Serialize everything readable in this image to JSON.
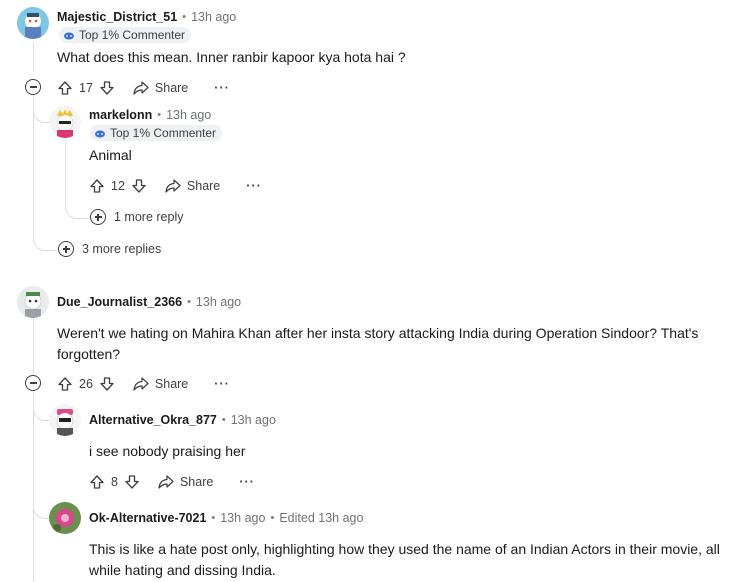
{
  "comments": [
    {
      "author": "Majestic_District_51",
      "time": "13h ago",
      "flair": "Top 1% Commenter",
      "body": "What does this mean. Inner ranbir kapoor kya hota hai ?",
      "votes": "17",
      "share": "Share",
      "more": "···"
    },
    {
      "author": "markelonn",
      "time": "13h ago",
      "flair": "Top 1% Commenter",
      "body": "Animal",
      "votes": "12",
      "share": "Share",
      "more": "···",
      "more_replies": "1 more reply"
    },
    {
      "parent_more_replies": "3 more replies"
    },
    {
      "author": "Due_Journalist_2366",
      "time": "13h ago",
      "body": "Weren't we hating on Mahira Khan after her insta story attacking India during Operation Sindoor? That's forgotten?",
      "votes": "26",
      "share": "Share",
      "more": "···"
    },
    {
      "author": "Alternative_Okra_877",
      "time": "13h ago",
      "body": "i see nobody praising her",
      "votes": "8",
      "share": "Share",
      "more": "···"
    },
    {
      "author": "Ok-Alternative-7021",
      "time": "13h ago",
      "edited": "Edited 13h ago",
      "body": "This is like a hate post only, highlighting how they used the name of an Indian Actors in their movie, all while hating and dissing India."
    }
  ]
}
